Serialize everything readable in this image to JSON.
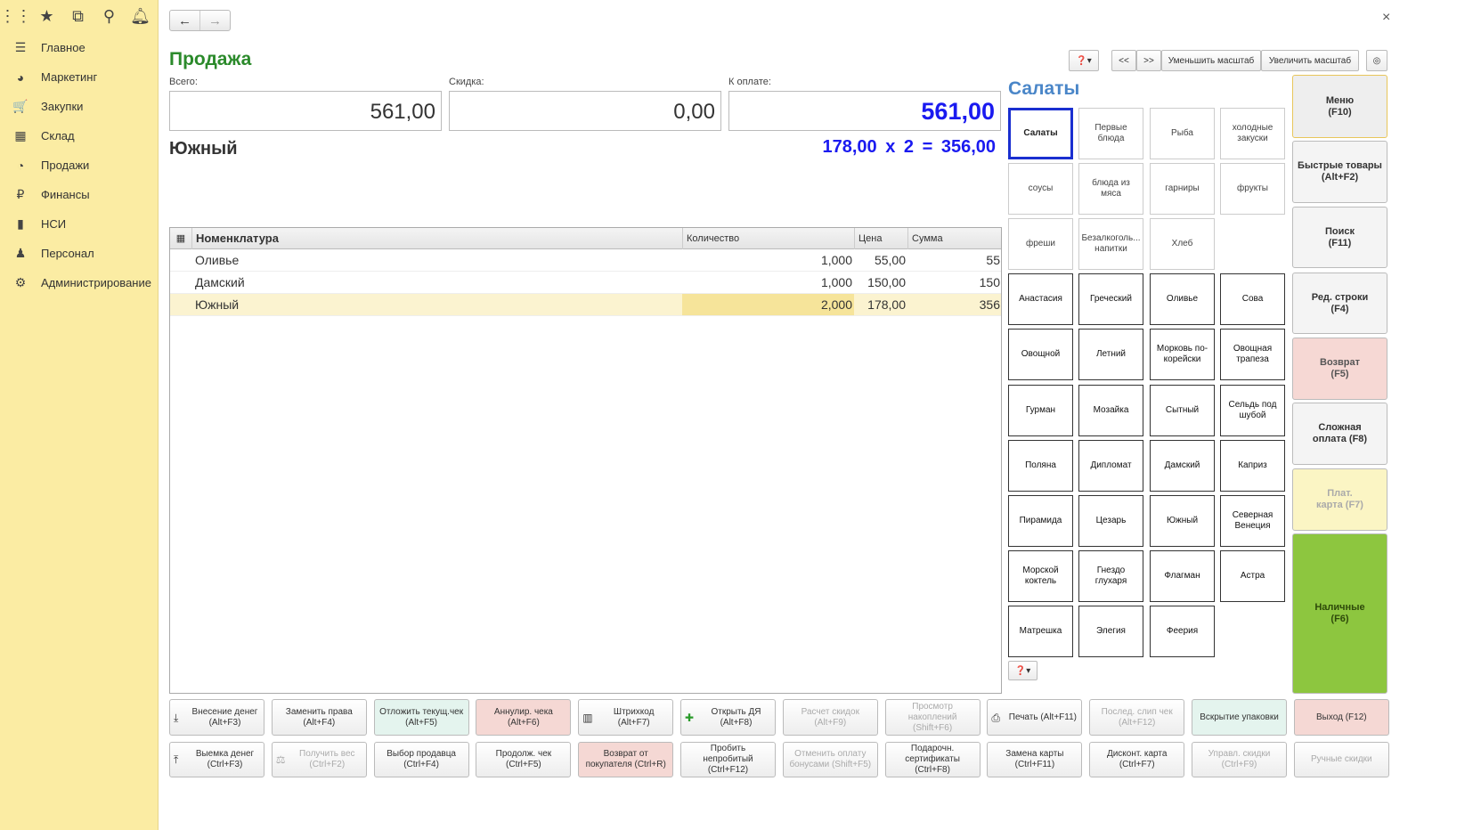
{
  "sidebar": {
    "top_icons": [
      "apps-icon",
      "star-icon",
      "history-icon",
      "search-icon",
      "bell-icon"
    ],
    "items": [
      {
        "icon": "menu-lines-icon",
        "glyph": "☰",
        "label": "Главное"
      },
      {
        "icon": "pie-chart-icon",
        "glyph": "◕",
        "label": "Маркетинг"
      },
      {
        "icon": "cart-icon",
        "glyph": "🛒",
        "label": "Закупки"
      },
      {
        "icon": "warehouse-grid-icon",
        "glyph": "▦",
        "label": "Склад"
      },
      {
        "icon": "sales-pie-icon",
        "glyph": "◔",
        "label": "Продажи"
      },
      {
        "icon": "ruble-icon",
        "glyph": "₽",
        "label": "Финансы"
      },
      {
        "icon": "book-icon",
        "glyph": "▮",
        "label": "НСИ"
      },
      {
        "icon": "person-icon",
        "glyph": "♟",
        "label": "Персонал"
      },
      {
        "icon": "gear-icon",
        "glyph": "⚙",
        "label": "Администрирование"
      }
    ]
  },
  "form": {
    "title": "Продажа",
    "total_label": "Всего:",
    "total_value": "561,00",
    "discount_label": "Скидка:",
    "discount_value": "0,00",
    "pay_label": "К оплате:",
    "pay_value": "561,00",
    "current_item": "Южный",
    "current_calc": "178,00  x 2  = 356,00"
  },
  "table": {
    "headers": {
      "name": "Номенклатура",
      "qty": "Количество",
      "price": "Цена",
      "sum": "Сумма"
    },
    "rows": [
      {
        "name": "Оливье",
        "qty": "1,000",
        "price": "55,00",
        "sum": "55"
      },
      {
        "name": "Дамский",
        "qty": "1,000",
        "price": "150,00",
        "sum": "150"
      },
      {
        "name": "Южный",
        "qty": "2,000",
        "price": "178,00",
        "sum": "356",
        "selected": true
      }
    ]
  },
  "toolbar": {
    "prev": "<<",
    "next": ">>",
    "zoom_out": "Уменьшить масштаб",
    "zoom_in": "Увеличить масштаб"
  },
  "catalog": {
    "title": "Салаты",
    "categories": [
      "Салаты",
      "Первые блюда",
      "Рыба",
      "холодные закуски",
      "соусы",
      "блюда из мяса",
      "гарниры",
      "фрукты",
      "фреши",
      "Безалкоголь... напитки",
      "Хлеб"
    ],
    "products": [
      "Анастасия",
      "Греческий",
      "Оливье",
      "Сова",
      "Овощной",
      "Летний",
      "Морковь по-корейски",
      "Овощная трапеза",
      "Гурман",
      "Мозайка",
      "Сытный",
      "Сельдь под шубой",
      "Поляна",
      "Дипломат",
      "Дамский",
      "Каприз",
      "Пирамида",
      "Цезарь",
      "Южный",
      "Северная Венеция",
      "Морской коктель",
      "Гнездо глухаря",
      "Флагман",
      "Астра",
      "Матрешка",
      "Элегия",
      "Феерия"
    ]
  },
  "side_buttons": [
    {
      "label": "Меню\n(F10)",
      "color": "#eeeeee",
      "text": "#333333"
    },
    {
      "label": "Быстрые товары\n(Alt+F2)",
      "color": "#f4f4f4",
      "text": "#333333"
    },
    {
      "label": "Поиск\n(F11)",
      "color": "#f4f4f4",
      "text": "#333333"
    },
    {
      "label": "Ред. строки\n(F4)",
      "color": "#f4f4f4",
      "text": "#333333"
    },
    {
      "label": "Возврат\n(F5)",
      "color": "#f6d8d4",
      "text": "#555555"
    },
    {
      "label": "Сложная\nоплата (F8)",
      "color": "#f4f4f4",
      "text": "#333333"
    },
    {
      "label": "Плат.\nкарта (F7)",
      "color": "#fbf5c4",
      "text": "#aaaaaa"
    },
    {
      "label": "Наличные\n(F6)",
      "color": "#8dc63f",
      "text": "#2e4a0a"
    }
  ],
  "bottom_row1": [
    {
      "label": "Внесение денег (Alt+F3)",
      "icon": "money-in-icon",
      "glyph": "⤓",
      "style": ""
    },
    {
      "label": "Заменить права (Alt+F4)",
      "style": ""
    },
    {
      "label": "Отложить текущ.чек (Alt+F5)",
      "style": "mint"
    },
    {
      "label": "Аннулир. чека (Alt+F6)",
      "style": "pink"
    },
    {
      "label": "Штрихкод (Alt+F7)",
      "icon": "barcode-icon",
      "glyph": "▥",
      "style": ""
    },
    {
      "label": "Открыть ДЯ (Alt+F8)",
      "icon": "plus-icon",
      "glyph": "✚",
      "style": ""
    },
    {
      "label": "Расчет скидок (Alt+F9)",
      "style": "dis"
    },
    {
      "label": "Просмотр накоплений (Shift+F6)",
      "style": "dis"
    },
    {
      "label": "Печать (Alt+F11)",
      "icon": "printer-icon",
      "glyph": "⎙",
      "style": ""
    },
    {
      "label": "Послед. слип чек (Alt+F12)",
      "style": "dis"
    },
    {
      "label": "Вскрытие упаковки",
      "style": "mint"
    },
    {
      "label": "Выход (F12)",
      "style": "pink"
    }
  ],
  "bottom_row2": [
    {
      "label": "Выемка денег (Ctrl+F3)",
      "icon": "money-out-icon",
      "glyph": "⤒",
      "style": ""
    },
    {
      "label": "Получить вес (Ctrl+F2)",
      "icon": "scale-icon",
      "glyph": "⚖",
      "style": "dis"
    },
    {
      "label": "Выбор продавца (Ctrl+F4)",
      "style": ""
    },
    {
      "label": "Продолж. чек (Ctrl+F5)",
      "style": ""
    },
    {
      "label": "Возврат от покупателя (Ctrl+R)",
      "style": "pink"
    },
    {
      "label": "Пробить непробитый (Ctrl+F12)",
      "style": ""
    },
    {
      "label": "Отменить оплату бонусами (Shift+F5)",
      "style": "dis"
    },
    {
      "label": "Подарочн. сертификаты (Ctrl+F8)",
      "style": ""
    },
    {
      "label": "Замена карты (Ctrl+F11)",
      "style": ""
    },
    {
      "label": "Дисконт. карта (Ctrl+F7)",
      "style": ""
    },
    {
      "label": "Управл. скидки (Ctrl+F9)",
      "style": "dis"
    },
    {
      "label": "Ручные скидки",
      "style": "dis"
    }
  ]
}
